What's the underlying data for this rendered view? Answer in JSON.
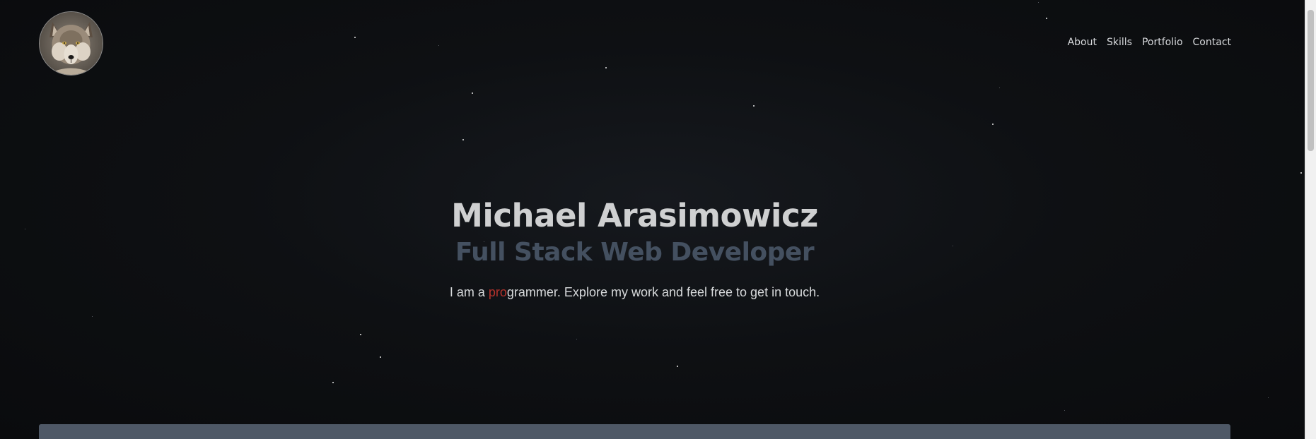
{
  "avatar": {
    "alt": "wolf portrait"
  },
  "nav": {
    "items": [
      {
        "label": "About"
      },
      {
        "label": "Skills"
      },
      {
        "label": "Portfolio"
      },
      {
        "label": "Contact"
      }
    ]
  },
  "hero": {
    "name": "Michael Arasimowicz",
    "title": "Full Stack Web Developer",
    "tagline_prefix": "I am a ",
    "tagline_typed": "pro",
    "tagline_rest": "grammer. Explore my work and feel free to get in touch."
  },
  "colors": {
    "background": "#0b0c0e",
    "name_text": "#cfd0d1",
    "title_text": "#445060",
    "typed_accent": "#b6332c",
    "panel": "#4e5866"
  }
}
